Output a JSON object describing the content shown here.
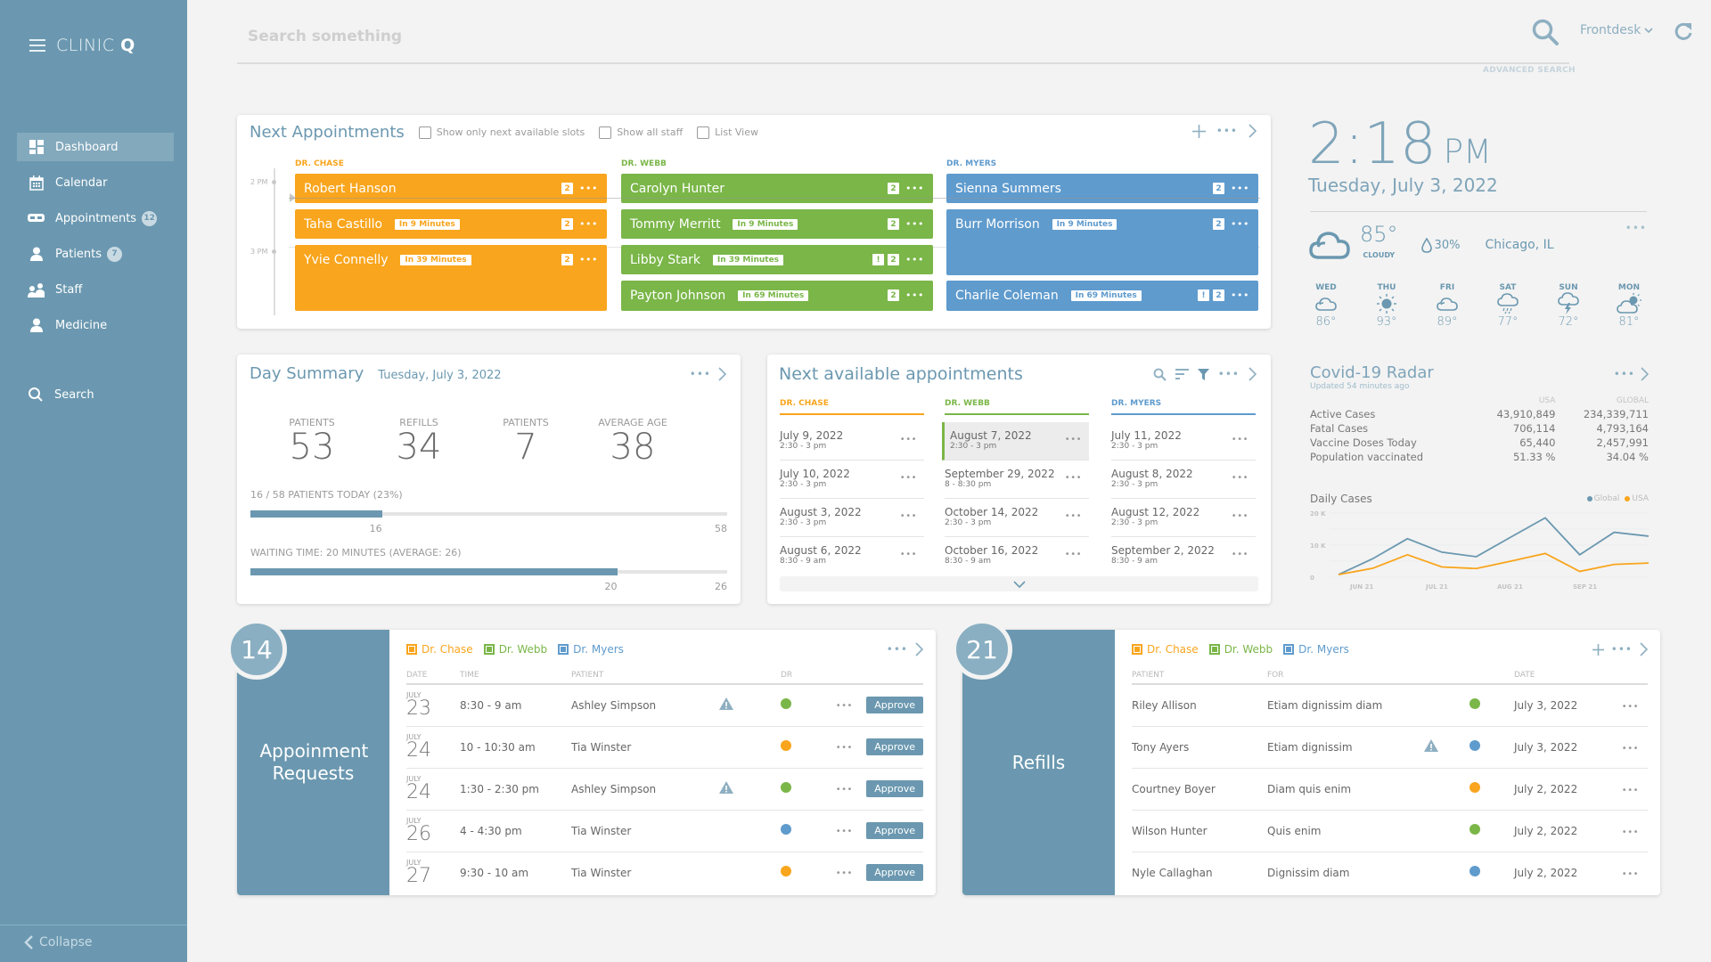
{
  "sidebar": {
    "brand": "CLINIC",
    "brand_bold": "Q",
    "items": [
      {
        "label": "Dashboard",
        "icon": "dashboard-icon",
        "active": true
      },
      {
        "label": "Calendar",
        "icon": "calendar-icon"
      },
      {
        "label": "Appointments",
        "icon": "appointments-icon",
        "badge": "12"
      },
      {
        "label": "Patients",
        "icon": "patient-icon",
        "badge": "7"
      },
      {
        "label": "Staff",
        "icon": "staff-icon"
      },
      {
        "label": "Medicine",
        "icon": "medicine-icon"
      }
    ],
    "search_label": "Search",
    "collapse_label": "Collapse"
  },
  "header": {
    "search_placeholder": "Search something",
    "advanced_search": "ADVANCED SEARCH",
    "user_role": "Frontdesk"
  },
  "colors": {
    "primary": "#6b98b0",
    "chase": "#f9a51d",
    "webb": "#7ab648",
    "myers": "#5f9bcd"
  },
  "next_appointments": {
    "title": "Next Appointments",
    "options": [
      "Show only next available slots",
      "Show all staff",
      "List View"
    ],
    "time_labels": [
      "2 PM",
      "3 PM"
    ],
    "doctors": [
      {
        "name": "DR. CHASE",
        "appointments": [
          {
            "patient": "Robert Hanson",
            "eta": "",
            "count": "2",
            "alert": false
          },
          {
            "patient": "Taha Castillo",
            "eta": "In 9 Minutes",
            "count": "2",
            "alert": false
          },
          {
            "patient": "Yvie Connelly",
            "eta": "In 39 Minutes",
            "count": "2",
            "alert": false
          }
        ]
      },
      {
        "name": "DR. WEBB",
        "appointments": [
          {
            "patient": "Carolyn Hunter",
            "eta": "",
            "count": "2",
            "alert": false
          },
          {
            "patient": "Tommy Merritt",
            "eta": "In 9 Minutes",
            "count": "2",
            "alert": false
          },
          {
            "patient": "Libby Stark",
            "eta": "In 39 Minutes",
            "count": "2",
            "alert": true
          },
          {
            "patient": "Payton Johnson",
            "eta": "In 69 Minutes",
            "count": "2",
            "alert": false
          }
        ]
      },
      {
        "name": "DR. MYERS",
        "appointments": [
          {
            "patient": "Sienna Summers",
            "eta": "",
            "count": "2",
            "alert": false
          },
          {
            "patient": "Burr Morrison",
            "eta": "In 9 Minutes",
            "count": "2",
            "alert": false
          },
          {
            "patient": "Charlie Coleman",
            "eta": "In 69 Minutes",
            "count": "2",
            "alert": true
          }
        ]
      }
    ]
  },
  "day_summary": {
    "title": "Day Summary",
    "date": "Tuesday, July 3, 2022",
    "stats": [
      {
        "label": "PATIENTS",
        "value": "53"
      },
      {
        "label": "REFILLS",
        "value": "34"
      },
      {
        "label": "PATIENTS",
        "value": "7"
      },
      {
        "label": "AVERAGE AGE",
        "value": "38"
      }
    ],
    "patients_progress": {
      "label": "16 / 58 PATIENTS TODAY (23%)",
      "current": 16,
      "total": 58,
      "current_label": "16",
      "total_label": "58"
    },
    "waiting_progress": {
      "label": "WAITING TIME: 20 MINUTES (AVERAGE: 26)",
      "current": 20,
      "total": 26,
      "current_label": "20",
      "total_label": "26"
    }
  },
  "next_available": {
    "title": "Next available appointments",
    "columns": [
      {
        "doctor": "DR. CHASE",
        "slots": [
          {
            "date": "July 9, 2022",
            "time": "2:30 - 3 pm"
          },
          {
            "date": "July 10, 2022",
            "time": "2:30 - 3 pm"
          },
          {
            "date": "August 3, 2022",
            "time": "2:30 - 3 pm"
          },
          {
            "date": "August 6, 2022",
            "time": "8:30 - 9 am"
          }
        ]
      },
      {
        "doctor": "DR. WEBB",
        "slots": [
          {
            "date": "August 7, 2022",
            "time": "2:30 - 3 pm",
            "selected": true
          },
          {
            "date": "September 29, 2022",
            "time": "8 - 8:30 pm"
          },
          {
            "date": "October 14, 2022",
            "time": "2:30 - 3 pm"
          },
          {
            "date": "October 16, 2022",
            "time": "8:30 - 9 am"
          }
        ]
      },
      {
        "doctor": "DR. MYERS",
        "slots": [
          {
            "date": "July 11, 2022",
            "time": "2:30 - 3 pm"
          },
          {
            "date": "August 8, 2022",
            "time": "2:30 - 3 pm"
          },
          {
            "date": "August 12, 2022",
            "time": "2:30 - 3 pm"
          },
          {
            "date": "September 2, 2022",
            "time": "8:30 - 9 am"
          }
        ]
      }
    ]
  },
  "clock": {
    "time": "2:18",
    "ampm": "PM",
    "date": "Tuesday, July 3, 2022"
  },
  "weather": {
    "temp": "85°",
    "condition": "CLOUDY",
    "humidity": "30%",
    "city": "Chicago, IL",
    "forecast": [
      {
        "day": "WED",
        "icon": "cloud-icon",
        "temp": "86°"
      },
      {
        "day": "THU",
        "icon": "sun-icon",
        "temp": "93°"
      },
      {
        "day": "FRI",
        "icon": "cloud-icon",
        "temp": "89°"
      },
      {
        "day": "SAT",
        "icon": "rain-icon",
        "temp": "77°"
      },
      {
        "day": "SUN",
        "icon": "thunder-icon",
        "temp": "72°"
      },
      {
        "day": "MON",
        "icon": "partly-cloudy-icon",
        "temp": "81°"
      }
    ]
  },
  "covid": {
    "title": "Covid-19 Radar",
    "updated": "Updated 54 minutes ago",
    "col_usa": "USA",
    "col_global": "GLOBAL",
    "rows": [
      {
        "label": "Active Cases",
        "usa": "43,910,849",
        "global": "234,339,711"
      },
      {
        "label": "Fatal Cases",
        "usa": "706,114",
        "global": "4,793,164"
      },
      {
        "label": "Vaccine Doses Today",
        "usa": "65,440",
        "global": "2,457,991"
      },
      {
        "label": "Population vaccinated",
        "usa": "51.33 %",
        "global": "34.04 %"
      }
    ]
  },
  "chart_data": {
    "type": "line",
    "title": "Daily Cases",
    "x": [
      "Jun 21 (start)",
      "",
      "",
      "Jul 21",
      "",
      "Aug 21",
      "",
      "",
      "Sep 21",
      "",
      ""
    ],
    "tick_labels": [
      "JUN 21",
      "JUL 21",
      "AUG 21",
      "SEP 21"
    ],
    "y_tick_labels": [
      "0",
      "10 K",
      "20 K"
    ],
    "ylim": [
      0,
      20000
    ],
    "legend": "top-right",
    "grid": true,
    "series": [
      {
        "name": "Global",
        "color": "#6b98b0",
        "values": [
          800,
          5800,
          12000,
          7800,
          6400,
          12500,
          18500,
          7000,
          14000,
          12800
        ]
      },
      {
        "name": "USA",
        "color": "#f9a51d",
        "values": [
          800,
          2800,
          7000,
          3200,
          2700,
          5000,
          7400,
          1800,
          4000,
          4400
        ]
      }
    ]
  },
  "appointment_requests": {
    "count": "14",
    "title": "Appoinment Requests",
    "filters": [
      "Dr. Chase",
      "Dr. Webb",
      "Dr. Myers"
    ],
    "headers": [
      "DATE",
      "TIME",
      "PATIENT",
      "",
      "DR",
      ""
    ],
    "approve_label": "Approve",
    "rows": [
      {
        "month": "JULY",
        "day": "23",
        "time": "8:30 - 9 am",
        "patient": "Ashley Simpson",
        "warning": true,
        "dr": "webb"
      },
      {
        "month": "JULY",
        "day": "24",
        "time": "10 - 10:30 am",
        "patient": "Tia Winster",
        "warning": false,
        "dr": "chase"
      },
      {
        "month": "JULY",
        "day": "24",
        "time": "1:30 - 2:30 pm",
        "patient": "Ashley Simpson",
        "warning": true,
        "dr": "webb"
      },
      {
        "month": "JULY",
        "day": "26",
        "time": "4 - 4:30 pm",
        "patient": "Tia Winster",
        "warning": false,
        "dr": "myers"
      },
      {
        "month": "JULY",
        "day": "27",
        "time": "9:30 - 10 am",
        "patient": "Tia Winster",
        "warning": false,
        "dr": "chase"
      }
    ]
  },
  "refills": {
    "count": "21",
    "title": "Refills",
    "filters": [
      "Dr. Chase",
      "Dr. Webb",
      "Dr. Myers"
    ],
    "headers": [
      "PATIENT",
      "FOR",
      "",
      "",
      "DATE",
      ""
    ],
    "rows": [
      {
        "patient": "Riley Allison",
        "for": "Etiam dignissim diam",
        "warning": false,
        "dr": "webb",
        "date": "July 3, 2022"
      },
      {
        "patient": "Tony Ayers",
        "for": "Etiam dignissim",
        "warning": true,
        "dr": "myers",
        "date": "July 3, 2022"
      },
      {
        "patient": "Courtney Boyer",
        "for": "Diam quis enim",
        "warning": false,
        "dr": "chase",
        "date": "July 2, 2022"
      },
      {
        "patient": "Wilson Hunter",
        "for": "Quis enim",
        "warning": false,
        "dr": "webb",
        "date": "July 2, 2022"
      },
      {
        "patient": "Nyle Callaghan",
        "for": "Dignissim diam",
        "warning": false,
        "dr": "myers",
        "date": "July 2, 2022"
      }
    ]
  }
}
